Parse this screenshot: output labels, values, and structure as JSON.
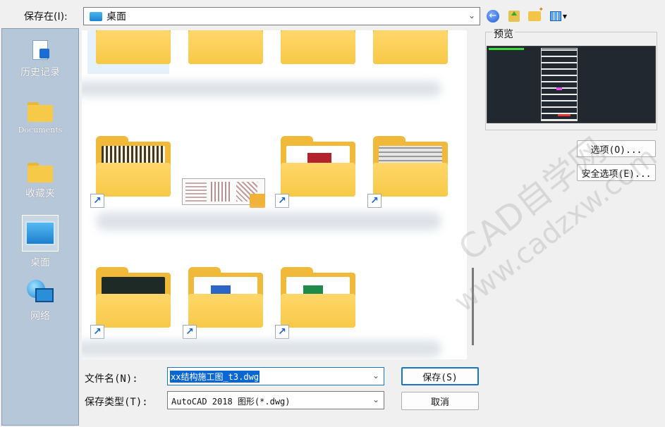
{
  "toolbar": {
    "save_in_label": "保存在(I):",
    "location": "桌面"
  },
  "places": [
    {
      "label": "历史记录",
      "icon": "history-icon"
    },
    {
      "label": "Documents",
      "icon": "folder-icon"
    },
    {
      "label": "收藏夹",
      "icon": "folder-icon"
    },
    {
      "label": "桌面",
      "icon": "desktop-icon"
    },
    {
      "label": "网络",
      "icon": "network-icon"
    }
  ],
  "preview": {
    "label": "预览"
  },
  "buttons": {
    "options": "选项(O)...",
    "security": "安全选项(E)...",
    "save": "保存(S)",
    "cancel": "取消"
  },
  "file_name": {
    "label": "文件名(N):",
    "value": "xx结构施工图_t3.dwg"
  },
  "file_type": {
    "label": "保存类型(T):",
    "value": "AutoCAD 2018 图形(*.dwg)"
  },
  "watermark": {
    "line1": "CAD自学网",
    "line2": "www.cadzxw.com"
  },
  "colors": {
    "accent": "#1a73c5",
    "folder": "#f7c948",
    "places_bg": "#b6c7d9"
  }
}
